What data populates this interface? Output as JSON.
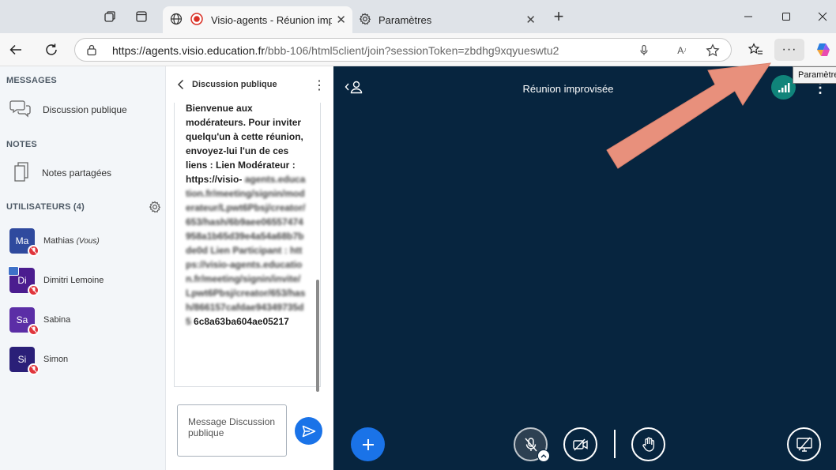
{
  "browser": {
    "tabs": [
      {
        "label": "Visio-agents - Réunion improvisée"
      },
      {
        "label": "Paramètres"
      }
    ],
    "url_host": "https://agents.visio.education.fr",
    "url_rest": "/bbb-106/html5client/join?sessionToken=zbdhg9xqyueswtu2",
    "tooltip": "Paramètres",
    "more_label": "···"
  },
  "sidebar": {
    "messages_header": "MESSAGES",
    "public_chat_label": "Discussion publique",
    "notes_header": "NOTES",
    "shared_notes_label": "Notes partagées",
    "users_header": "UTILISATEURS (4)",
    "users": [
      {
        "initials": "Ma",
        "name": "Mathias",
        "suffix": "(Vous)",
        "color": "#2f4a9e"
      },
      {
        "initials": "Di",
        "name": "Dimitri Lemoine",
        "suffix": "",
        "color": "#4b1d8f"
      },
      {
        "initials": "Sa",
        "name": "Sabina",
        "suffix": "",
        "color": "#5b2ea6"
      },
      {
        "initials": "Si",
        "name": "Simon",
        "suffix": "",
        "color": "#2a1f78"
      }
    ]
  },
  "chat": {
    "title": "Discussion publique",
    "message_visible": "Bienvenue aux modérateurs. Pour inviter quelqu'un à cette réunion, envoyez-lui l'un de ces liens : Lien Modérateur : https://visio-",
    "message_blurred": "agents.education.fr/meeting/signin/moderateur/Lpwt6Pbsj/creator/653/hash/6b9aee06557474958a1b65d39e4a54a68b7bde0d Lien Participant : https://visio-agents.education.fr/meeting/signin/invite/Lpwt6Pbsj/creator/653/hash/866157cafdae94349735d5",
    "message_end": "6c8a63ba604ae05217",
    "composer_placeholder": "Message Discussion publique"
  },
  "meeting": {
    "title": "Réunion improvisée"
  },
  "colors": {
    "accent": "#1a73e8",
    "meeting_bg": "#07253f",
    "connection": "#10847a",
    "arrow": "#e8907c"
  }
}
